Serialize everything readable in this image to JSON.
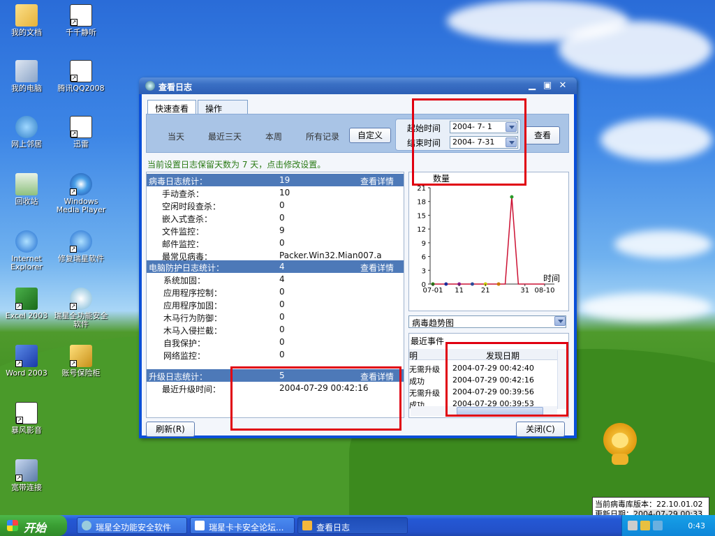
{
  "desktop": {
    "icons": [
      {
        "label": "我的文档",
        "icon": "my-documents-icon"
      },
      {
        "label": "千千静听",
        "icon": "ttplayer-icon"
      },
      {
        "label": "我的电脑",
        "icon": "my-computer-icon"
      },
      {
        "label": "腾讯QQ2008",
        "icon": "qq-icon"
      },
      {
        "label": "网上邻居",
        "icon": "network-icon"
      },
      {
        "label": "迅雷",
        "icon": "thunder-icon"
      },
      {
        "label": "回收站",
        "icon": "recycle-bin-icon"
      },
      {
        "label": "Windows Media Player",
        "icon": "media-player-icon"
      },
      {
        "label": "Internet Explorer",
        "icon": "ie-icon"
      },
      {
        "label": "修复瑞星软件",
        "icon": "repair-icon"
      },
      {
        "label": "Excel 2003",
        "icon": "excel-icon"
      },
      {
        "label": "瑞星全功能安全软件",
        "icon": "rising-icon"
      },
      {
        "label": "Word 2003",
        "icon": "word-icon"
      },
      {
        "label": "账号保险柜",
        "icon": "vault-icon"
      },
      {
        "label": "暴风影音",
        "icon": "storm-icon"
      },
      {
        "label": "宽带连接",
        "icon": "broadband-icon"
      }
    ]
  },
  "window": {
    "title": "查看日志",
    "tabs": [
      "快速查看",
      "操作"
    ],
    "filters": [
      "当天",
      "最近三天",
      "本周",
      "所有记录"
    ],
    "custom_button": "自定义",
    "start_label": "起始时间",
    "end_label": "结束时间",
    "start_date": "2004- 7- 1",
    "end_date": "2004- 7-31",
    "view_button": "查看",
    "notice": "当前设置日志保留天数为 7 天，点击修改设置。",
    "refresh_button": "刷新(R)",
    "close_button": "关闭(C)"
  },
  "stats": {
    "virus_head": {
      "label": "病毒日志统计：",
      "value": "19",
      "detail": "查看详情"
    },
    "virus_rows": [
      {
        "label": "手动查杀：",
        "value": "10"
      },
      {
        "label": "空闲时段查杀：",
        "value": "0"
      },
      {
        "label": "嵌入式查杀：",
        "value": "0"
      },
      {
        "label": "文件监控：",
        "value": "9"
      },
      {
        "label": "邮件监控：",
        "value": "0"
      },
      {
        "label": "最常见病毒：",
        "value": "Packer.Win32.Mian007.a"
      }
    ],
    "protect_head": {
      "label": "电脑防护日志统计：",
      "value": "4",
      "detail": "查看详情"
    },
    "protect_rows": [
      {
        "label": "系统加固：",
        "value": "4"
      },
      {
        "label": "应用程序控制：",
        "value": "0"
      },
      {
        "label": "应用程序加固：",
        "value": "0"
      },
      {
        "label": "木马行为防御：",
        "value": "0"
      },
      {
        "label": "木马入侵拦截：",
        "value": "0"
      },
      {
        "label": "自我保护：",
        "value": "0"
      },
      {
        "label": "网络监控：",
        "value": "0"
      }
    ],
    "upgrade_head": {
      "label": "升级日志统计：",
      "value": "5",
      "detail": "查看详情"
    },
    "upgrade_rows": [
      {
        "label": "最近升级时间：",
        "value": "2004-07-29 00:42:16"
      }
    ]
  },
  "chart_data": {
    "type": "line",
    "ylabel": "数量",
    "xlabel": "时间",
    "x": [
      "07-01",
      "07-03",
      "07-06",
      "07-08",
      "07-11",
      "07-14",
      "07-16",
      "07-18",
      "07-21",
      "07-23",
      "07-25",
      "07-28",
      "07-29",
      "07-30",
      "07-31",
      "08-03",
      "08-06",
      "08-10"
    ],
    "values": [
      0,
      0,
      0,
      0,
      0,
      0,
      0,
      0,
      0,
      0,
      0,
      0,
      19,
      0,
      0,
      0,
      0,
      0
    ],
    "x_ticks": [
      "07-01",
      "11",
      "21",
      "31",
      "08-10"
    ],
    "y_ticks": [
      "0",
      "3",
      "6",
      "9",
      "12",
      "15",
      "18",
      "21"
    ],
    "ylim": [
      0,
      21
    ],
    "line_color": "#cc1133",
    "marker_colors": [
      "#2a7a14",
      "#1a2a9a",
      "#8a1a8a",
      "#2a4a9a",
      "#cccc00",
      "#cc7700",
      "#7a1a7a",
      "#cc1133",
      "#2a7a14"
    ]
  },
  "chart_type_select": "病毒趋势图",
  "events": {
    "title": "最近事件",
    "col1": "明",
    "col2": "发现日期",
    "rows": [
      {
        "c1": "无需升级",
        "c2": "2004-07-29 00:42:40"
      },
      {
        "c1": "成功",
        "c2": "2004-07-29 00:42:16"
      },
      {
        "c1": "无需升级",
        "c2": "2004-07-29 00:39:56"
      },
      {
        "c1": "成功",
        "c2": "2004-07-29 00:39:53"
      }
    ]
  },
  "taskbar": {
    "start": "开始",
    "tasks": [
      "瑞星全功能安全软件",
      "瑞星卡卡安全论坛...",
      "查看日志"
    ],
    "clock": "0:43"
  },
  "dbinfo": {
    "version_label": "当前病毒库版本：",
    "version": "22.10.01.02",
    "date_label": "更新日期：",
    "date": "2004-07-29 00:33"
  }
}
